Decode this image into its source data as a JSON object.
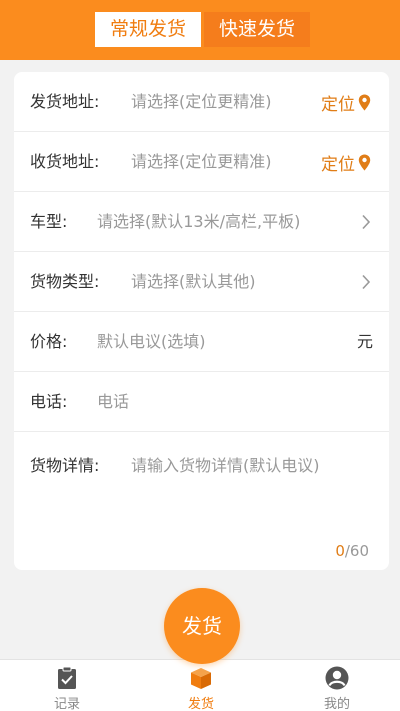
{
  "header": {
    "tabs": [
      {
        "label": "常规发货",
        "active": true
      },
      {
        "label": "快速发货",
        "active": false
      }
    ]
  },
  "form": {
    "origin": {
      "label": "发货地址:",
      "placeholder": "请选择(定位更精准)",
      "action": "定位",
      "icon": "location-pin-icon"
    },
    "destination": {
      "label": "收货地址:",
      "placeholder": "请选择(定位更精准)",
      "action": "定位",
      "icon": "location-pin-icon"
    },
    "vehicle": {
      "label": "车型:",
      "placeholder": "请选择(默认13米/高栏,平板)",
      "icon": "chevron-right-icon"
    },
    "cargo_type": {
      "label": "货物类型:",
      "placeholder": "请选择(默认其他)",
      "icon": "chevron-right-icon"
    },
    "price": {
      "label": "价格:",
      "placeholder": "默认电议(选填)",
      "unit": "元"
    },
    "phone": {
      "label": "电话:",
      "placeholder": "电话"
    },
    "details": {
      "label": "货物详情:",
      "placeholder": "请输入货物详情(默认电议)",
      "count": "0",
      "max": "/60"
    }
  },
  "submit": {
    "label": "发货"
  },
  "tabbar": {
    "items": [
      {
        "label": "记录",
        "icon": "clipboard-check-icon",
        "active": false
      },
      {
        "label": "发货",
        "icon": "package-box-icon",
        "active": true
      },
      {
        "label": "我的",
        "icon": "user-avatar-icon",
        "active": false
      }
    ]
  },
  "colors": {
    "accent": "#fb8c1e",
    "accent_text": "#e07d17",
    "placeholder": "#999999"
  }
}
